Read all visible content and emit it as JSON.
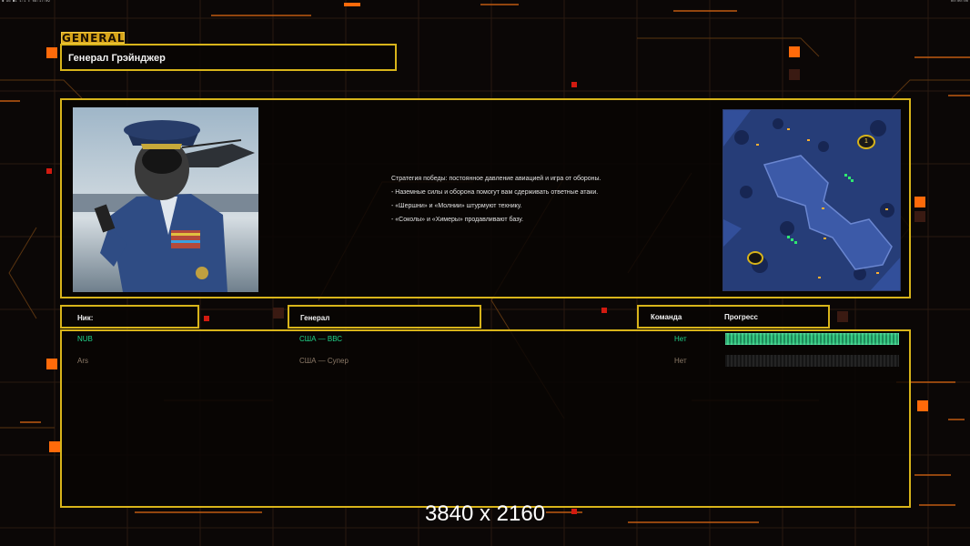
{
  "system_bar": {
    "left_text": "◆ 96 ■1 1:1 ▸ 08:17:09",
    "right_text": "00:00:00"
  },
  "tab_label": "GENERAL",
  "general_name": "Генерал Грэйнджер",
  "description": [
    "Стратегия победы: постоянное давление авиацией и игра от обороны.",
    "- Наземные силы и оборона помогут вам сдерживать ответные атаки.",
    "- «Шершни» и «Молнии» штурмуют технику.",
    "- «Соколы» и «Химеры» продавливают базу."
  ],
  "columns": {
    "nick": "Ник:",
    "general": "Генерал",
    "team": "Команда",
    "progress": "Прогресс"
  },
  "players": [
    {
      "nick": "NUB",
      "general": "США — ВВС",
      "team": "Нет",
      "progress": 1.0,
      "color": "#21d38a"
    },
    {
      "nick": "Ars",
      "general": "США — Супер",
      "team": "Нет",
      "progress": 0.0,
      "color": "#8c7a68"
    }
  ],
  "minimap": {
    "start_markers": [
      "1",
      ""
    ]
  },
  "watermark": "3840 x 2160",
  "colors": {
    "accent": "#d8b41a",
    "orange": "#ff7a10",
    "ally": "#21d38a"
  }
}
